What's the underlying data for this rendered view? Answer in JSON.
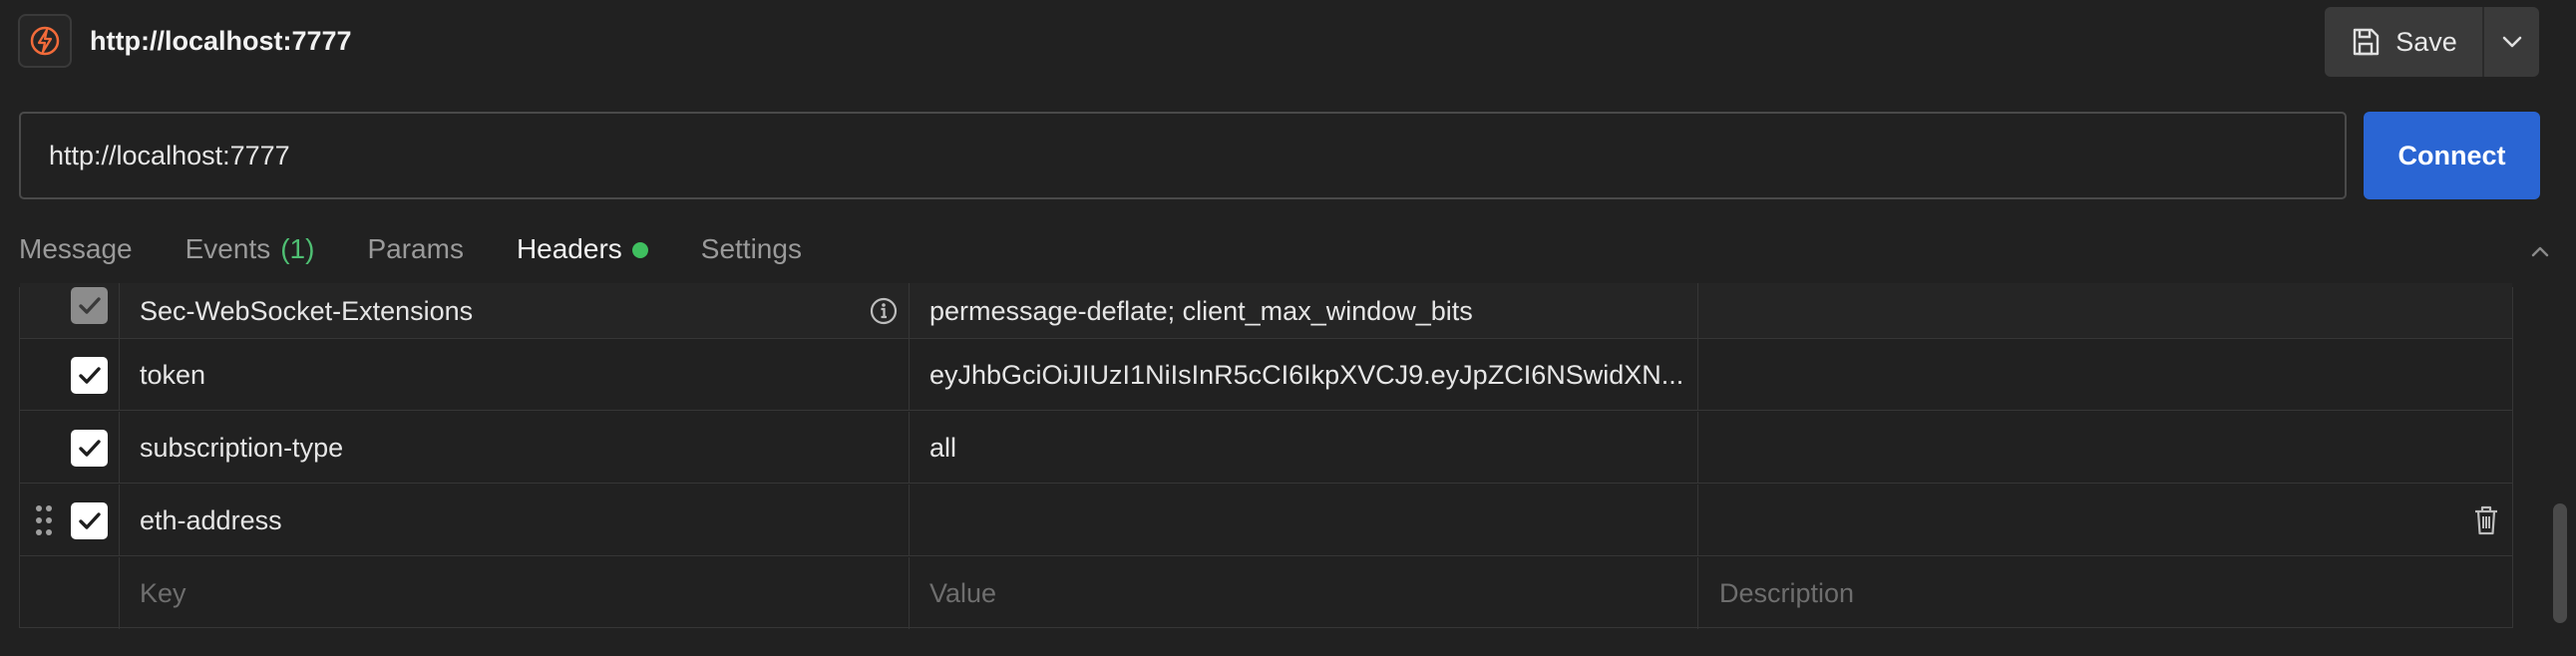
{
  "header": {
    "title": "http://localhost:7777",
    "save_label": "Save"
  },
  "url_bar": {
    "value": "http://localhost:7777",
    "connect_label": "Connect"
  },
  "tabs": [
    {
      "label": "Message"
    },
    {
      "label": "Events",
      "count": "(1)"
    },
    {
      "label": "Params"
    },
    {
      "label": "Headers",
      "active": true
    },
    {
      "label": "Settings"
    }
  ],
  "headers_table": {
    "rows": [
      {
        "key": "Sec-WebSocket-Extensions",
        "value": "permessage-deflate; client_max_window_bits",
        "description": ""
      },
      {
        "key": "token",
        "value": "eyJhbGciOiJIUzI1NiIsInR5cCI6IkpXVCJ9.eyJpZCI6NSwidXN...",
        "description": ""
      },
      {
        "key": "subscription-type",
        "value": "all",
        "description": ""
      },
      {
        "key": "eth-address",
        "value": "",
        "description": ""
      }
    ],
    "placeholders": {
      "key": "Key",
      "value": "Value",
      "description": "Description"
    }
  },
  "colors": {
    "accent": "#f26b3a",
    "connect": "#2a65d3",
    "status_dot": "#3fbf5f",
    "count": "#4fbf73"
  },
  "icons": [
    "app-logo-icon",
    "save-icon",
    "chevron-down-icon",
    "chevron-up-icon",
    "info-icon",
    "drag-handle-icon",
    "trash-icon",
    "checkmark-icon"
  ]
}
